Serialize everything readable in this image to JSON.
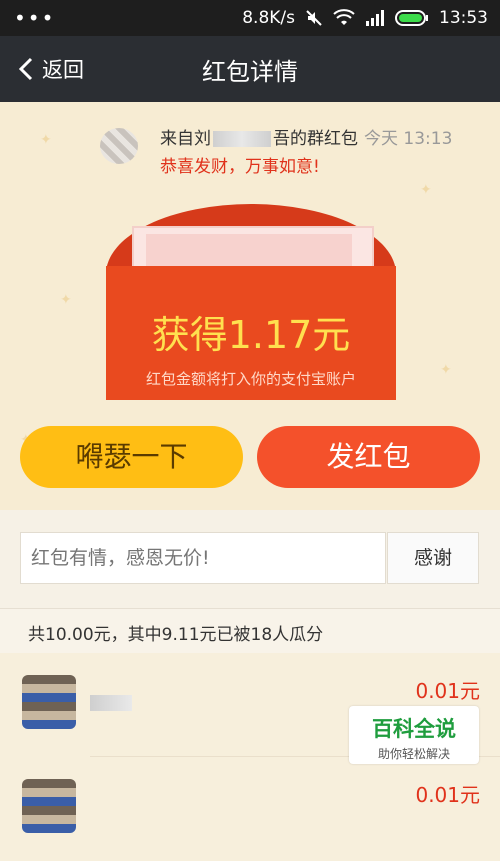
{
  "status_bar": {
    "speed": "8.8K/s",
    "time": "13:53"
  },
  "nav": {
    "back_label": "返回",
    "title": "红包详情"
  },
  "sender": {
    "from_prefix": "来自",
    "name_visible_start": "刘",
    "name_visible_end": "吾",
    "from_suffix": "的群红包",
    "time": "今天 13:13",
    "blessing": "恭喜发财，万事如意!"
  },
  "envelope": {
    "amount_text": "获得1.17元",
    "note": "红包金额将打入你的支付宝账户"
  },
  "buttons": {
    "left_label": "嘚瑟一下",
    "right_label": "发红包"
  },
  "thanks": {
    "placeholder": "红包有情，感恩无价!",
    "button_label": "感谢"
  },
  "summary": "共10.00元，其中9.11元已被18人瓜分",
  "records": [
    {
      "amount": "0.01元"
    },
    {
      "amount": "0.01元"
    }
  ],
  "watermark": {
    "brand": "百科全说",
    "slogan": "助你轻松解决"
  },
  "colors": {
    "accent_red": "#e94a1f",
    "accent_yellow": "#ffbe14",
    "nav_bg": "#2b2e33"
  }
}
